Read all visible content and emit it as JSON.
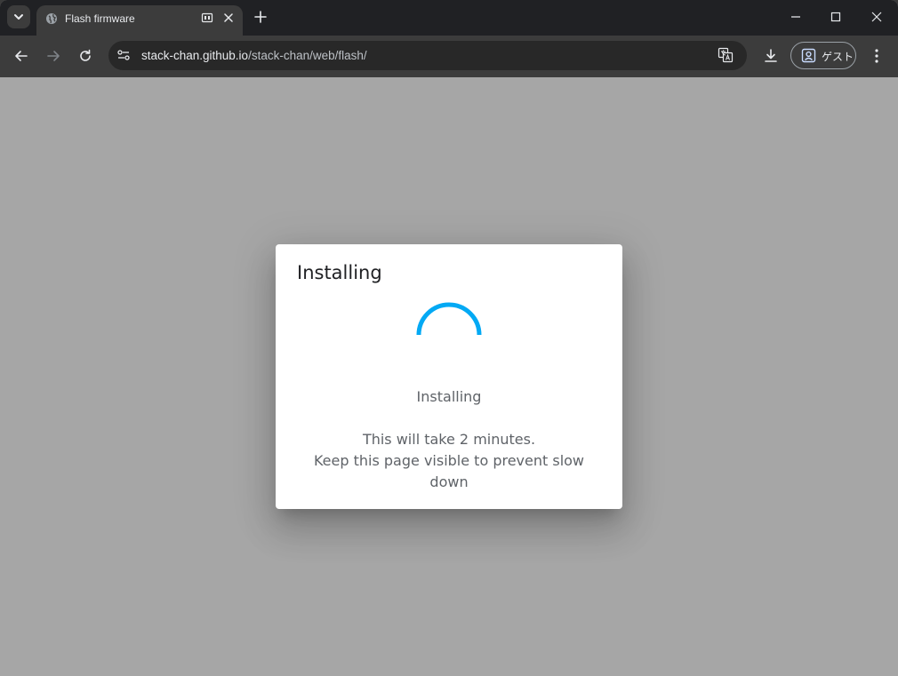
{
  "browser": {
    "tab_title": "Flash firmware",
    "url_host": "stack-chan.github.io",
    "url_path": "/stack-chan/web/flash/",
    "profile_label": "ゲスト"
  },
  "dialog": {
    "title": "Installing",
    "status": "Installing",
    "message_line1": "This will take 2 minutes.",
    "message_line2": "Keep this page visible to prevent slow down"
  },
  "colors": {
    "spinner": "#03a9f4",
    "overlay": "#a6a6a6",
    "dialog_bg": "#ffffff"
  },
  "icons": [
    "chevron-down-icon",
    "globe-icon",
    "media-icon",
    "close-icon",
    "plus-icon",
    "minimize-icon",
    "maximize-icon",
    "back-arrow-icon",
    "forward-arrow-icon",
    "reload-icon",
    "site-info-icon",
    "translate-icon",
    "download-icon",
    "profile-icon",
    "kebab-menu-icon",
    "spinner-icon"
  ]
}
